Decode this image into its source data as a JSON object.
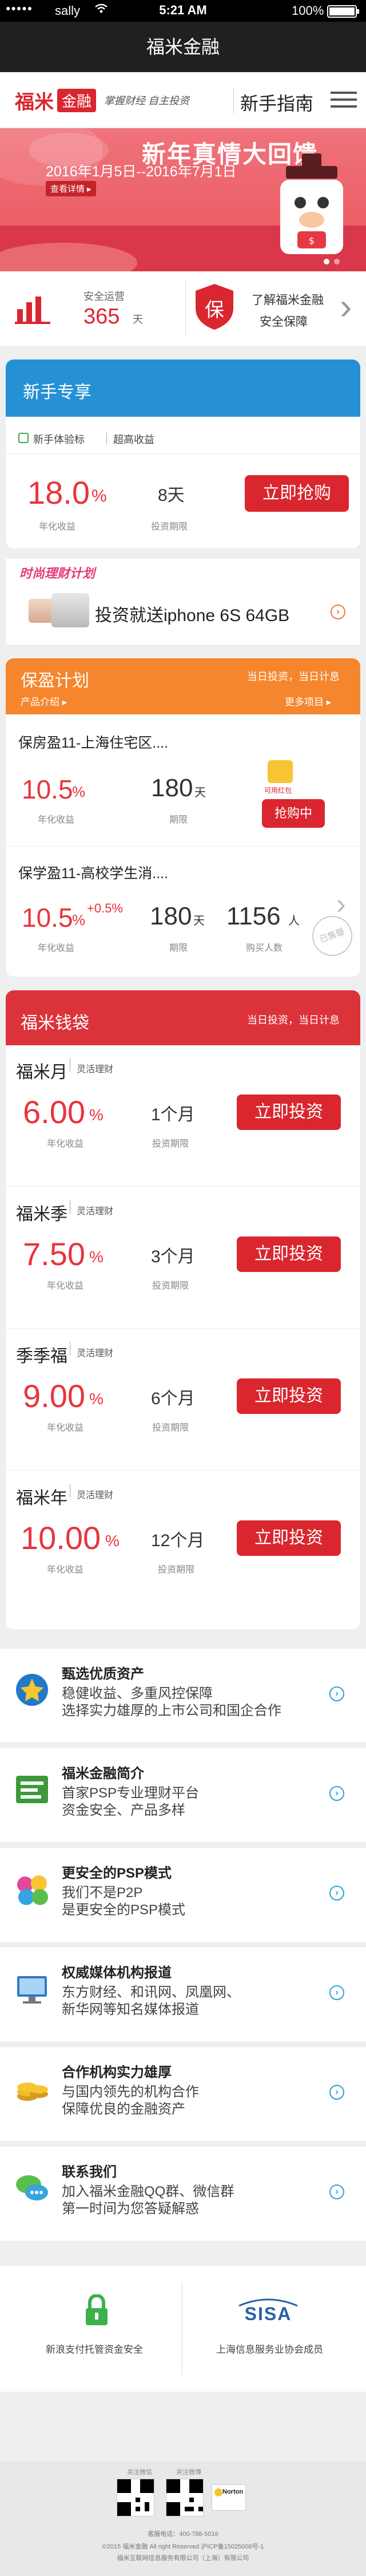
{
  "status_bar": {
    "carrier": "sally",
    "signal": "●●●●●",
    "time": "5:21 AM",
    "battery": "100%"
  },
  "title_bar": {
    "title": "福米金融"
  },
  "header": {
    "logo_cn": "福米",
    "logo_badge": "金融",
    "slogan": "掌握财经 自主投资",
    "guide": "新手指南"
  },
  "banner": {
    "title": "新年真情大回馈",
    "dates": "2016年1月5日--2016年7月1日",
    "link": "查看详情 ▸"
  },
  "stats": {
    "label": "安全运营",
    "days": "365",
    "unit": "天",
    "shield_char": "保",
    "learn": "了解福米金融",
    "security": "安全保障"
  },
  "newbie": {
    "header": "新手专享",
    "tag": "新手体验标",
    "tag2": "超高收益",
    "rate": "18.0",
    "pct": "%",
    "rate_label": "年化收益",
    "days": "8天",
    "days_label": "投资期限",
    "button": "立即抢购"
  },
  "promo": {
    "tag": "时尚理财计划",
    "text": "投资就送iphone 6S  64GB"
  },
  "baoying": {
    "header": "保盈计划",
    "header_right": "当日投资，当日计息",
    "sub_left": "产品介绍 ▸",
    "sub_right": "更多项目 ▸",
    "item1": {
      "name": "保房盈11-上海住宅区....",
      "rate": "10.5",
      "pct": "%",
      "rate_label": "年化收益",
      "period": "180",
      "unit": "天",
      "period_label": "期限",
      "bag": "可用红包",
      "button": "抢购中"
    },
    "item2": {
      "name": "保学盈11-高校学生消....",
      "rate": "10.5",
      "pct": "%",
      "extra": "+0.5%",
      "rate_label": "年化收益",
      "period": "180",
      "unit": "天",
      "period_label": "期限",
      "buyers": "1156",
      "buyers_unit": "人",
      "buyers_label": "购买人数",
      "stamp": "已售罄"
    }
  },
  "wallet": {
    "header": "福米钱袋",
    "header_right": "当日投资，当日计息",
    "items": [
      {
        "name": "福米月",
        "tag": "灵活理财",
        "rate": "6.00",
        "pct": "%",
        "rate_label": "年化收益",
        "term": "1个月",
        "term_label": "投资期限",
        "button": "立即投资"
      },
      {
        "name": "福米季",
        "tag": "灵活理财",
        "rate": "7.50",
        "pct": "%",
        "rate_label": "年化收益",
        "term": "3个月",
        "term_label": "投资期限",
        "button": "立即投资"
      },
      {
        "name": "季季福",
        "tag": "灵活理财",
        "rate": "9.00",
        "pct": "%",
        "rate_label": "年化收益",
        "term": "6个月",
        "term_label": "投资期限",
        "button": "立即投资"
      },
      {
        "name": "福米年",
        "tag": "灵活理财",
        "rate": "10.00",
        "pct": "%",
        "rate_label": "年化收益",
        "term": "12个月",
        "term_label": "投资期限",
        "button": "立即投资"
      }
    ]
  },
  "features": [
    {
      "title": "甄选优质资产",
      "desc": "稳健收益、多重风控保障\n选择实力雄厚的上市公司和国企合作"
    },
    {
      "title": "福米金融简介",
      "desc": "首家PSP专业理财平台\n资金安全、产品多样"
    },
    {
      "title": "更安全的PSP模式",
      "desc": "我们不是P2P\n是更安全的PSP模式"
    },
    {
      "title": "权威媒体机构报道",
      "desc": "东方财经、和讯网、凤凰网、\n新华网等知名媒体报道"
    },
    {
      "title": "合作机构实力雄厚",
      "desc": "与国内领先的机构合作\n保障优良的金融资产"
    },
    {
      "title": "联系我们",
      "desc": "加入福米金融QQ群、微信群\n第一时间为您答疑解惑"
    }
  ],
  "trust": {
    "left_label": "新浪支付托管资金安全",
    "logo": "SISA",
    "right_label": "上海信息服务业协会成员"
  },
  "footer": {
    "qr1": "关注微信",
    "qr2": "关注微博",
    "norton": "Norton",
    "phone": "客服电话：400-788-5016",
    "copyright": "©2015  福米金融 All right Reserved 沪ICP备15025008号-1",
    "company": "福米互联网信息服务有限公司（上海）有限公司"
  },
  "colors": {
    "accent_red": "#e8343c",
    "blue": "#2690d4",
    "orange": "#f5862d",
    "wallet_red": "#dc3239"
  }
}
